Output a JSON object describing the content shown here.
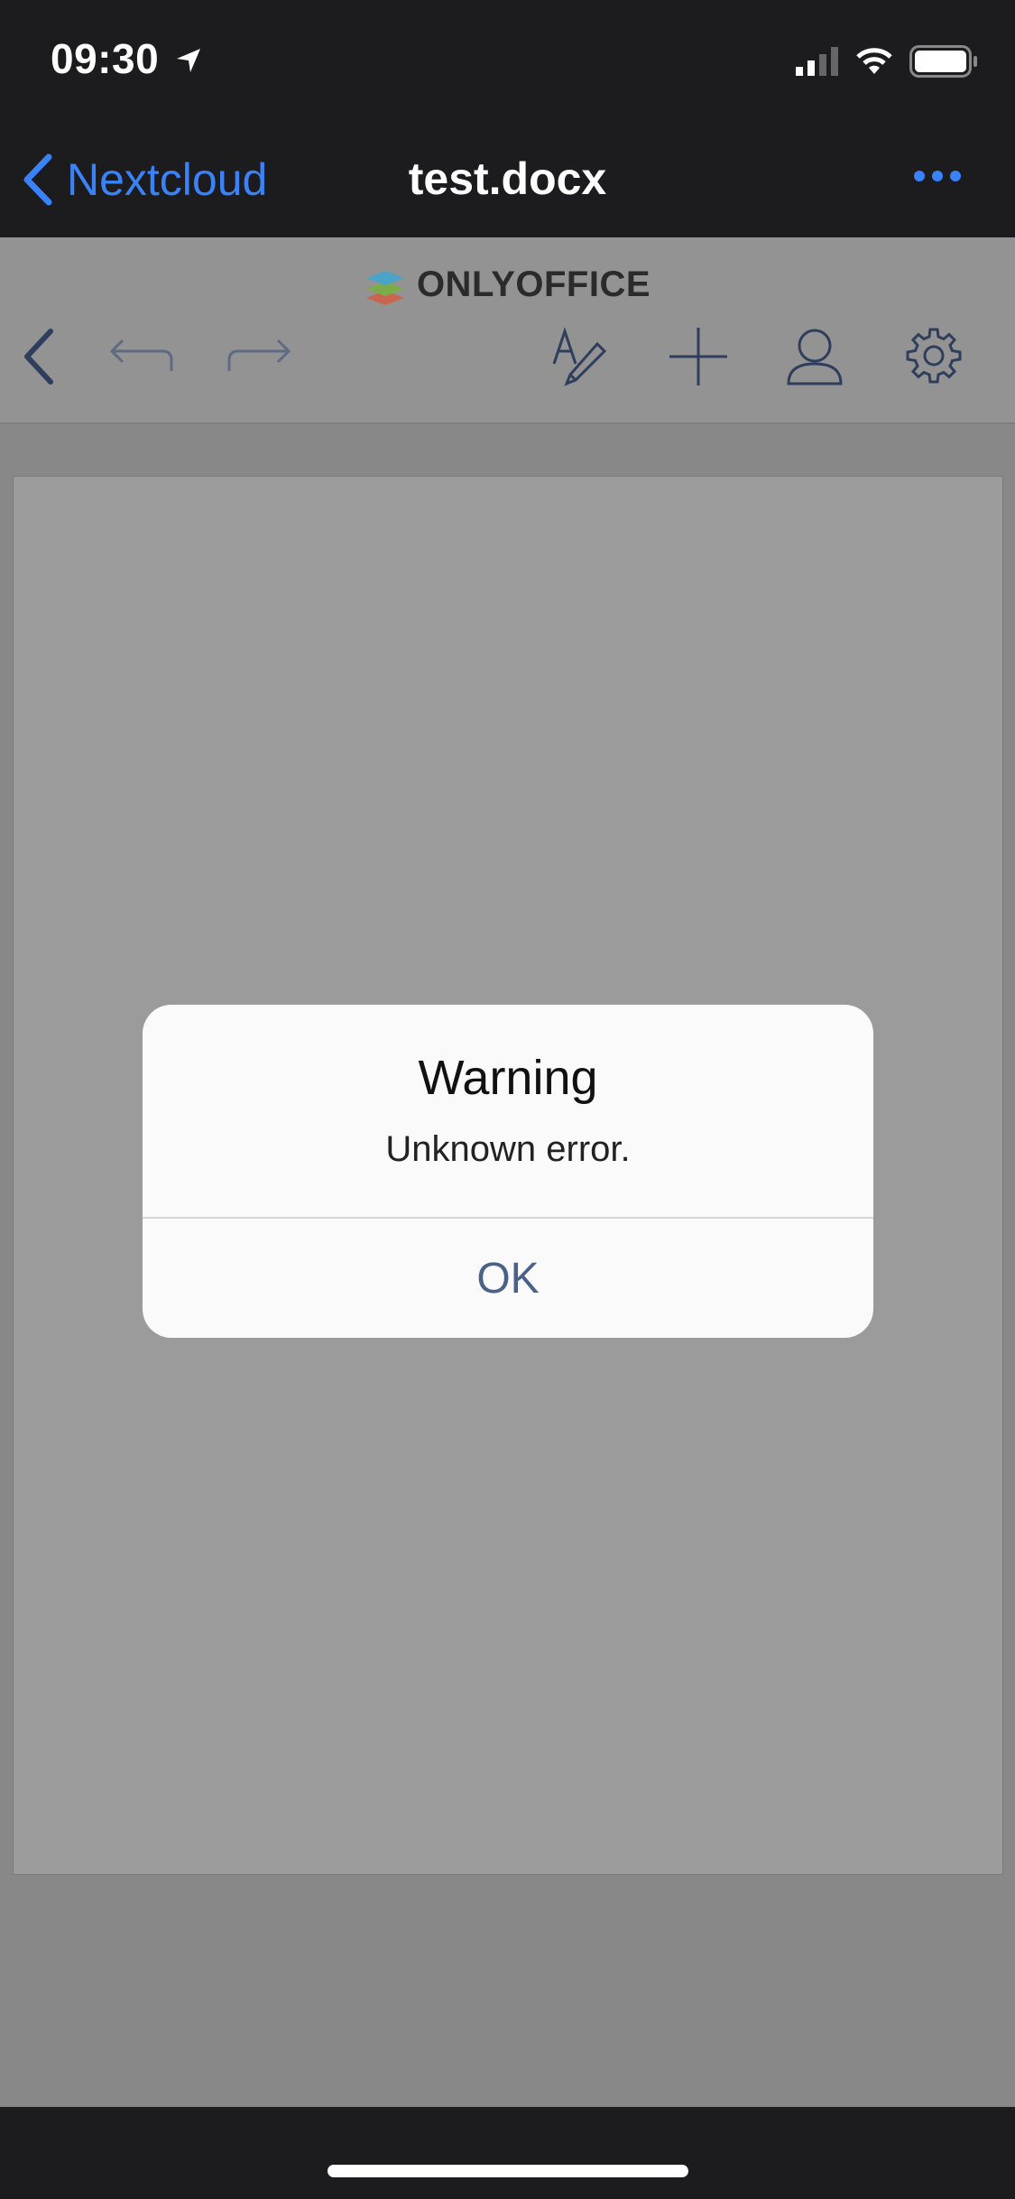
{
  "status_bar": {
    "time": "09:30"
  },
  "nav": {
    "back_label": "Nextcloud",
    "title": "test.docx"
  },
  "onlyoffice": {
    "logo_text": "ONLYOFFICE"
  },
  "toolbar": {
    "icons": [
      "chevron-left-icon",
      "undo-icon",
      "redo-icon",
      "edit-text-icon",
      "add-icon",
      "user-icon",
      "gear-icon"
    ]
  },
  "alert": {
    "title": "Warning",
    "message": "Unknown error.",
    "ok_label": "OK"
  },
  "colors": {
    "accent": "#3a82f7",
    "dark_bar": "#1c1c1e",
    "ok_text": "#4a6288"
  }
}
